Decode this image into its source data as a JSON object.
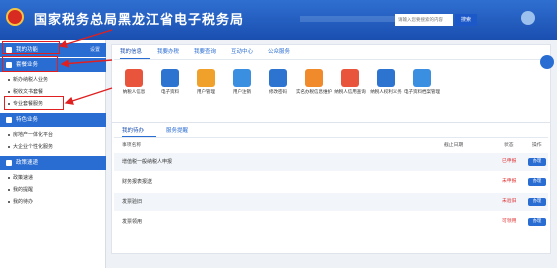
{
  "header": {
    "title": "国家税务总局黑龙江省电子税务局",
    "search_placeholder": "请输入您要搜索的内容",
    "search_label": "搜索"
  },
  "sidebar": {
    "sections": [
      {
        "label": "我的功能",
        "extra": "设置"
      },
      {
        "label": "套餐业务",
        "items": [
          "新办纳税人业务",
          "税收文书套餐",
          "专业套餐服务"
        ]
      },
      {
        "label": "特色业务",
        "items": [
          "房地产一体化平台",
          "大企业个性化服务"
        ]
      },
      {
        "label": "政策速递",
        "items": [
          "政策速递",
          "我的提醒",
          "我的待办"
        ]
      }
    ]
  },
  "main": {
    "tabs": [
      "我的信息",
      "我要办税",
      "我要查询",
      "互动中心",
      "公众服务"
    ],
    "functions": [
      {
        "label": "纳税人信息",
        "icon": "taxpayer-info-icon",
        "color": "#e9543d"
      },
      {
        "label": "电子资料",
        "icon": "electronic-data-icon",
        "color": "#2d74d0"
      },
      {
        "label": "用户管理",
        "icon": "user-management-icon",
        "color": "#f0a12b"
      },
      {
        "label": "用户注销",
        "icon": "user-cancel-icon",
        "color": "#3b8fe0"
      },
      {
        "label": "修改密码",
        "icon": "change-password-icon",
        "color": "#2d74d0"
      },
      {
        "label": "实名办税信息维护",
        "icon": "real-name-icon",
        "color": "#f08a2b"
      },
      {
        "label": "纳税人信用查询",
        "icon": "credit-query-icon",
        "color": "#e9543d"
      },
      {
        "label": "纳税人权利义务",
        "icon": "rights-icon",
        "color": "#2d74d0"
      },
      {
        "label": "电子资料档案管理",
        "icon": "archive-icon",
        "color": "#3b8fe0"
      }
    ],
    "todo": {
      "tabs": [
        "我的待办",
        "服务提醒"
      ],
      "columns": [
        "事项名称",
        "截止日期",
        "状态",
        "操作"
      ],
      "rows": [
        {
          "name": "增值税一般纳税人申报",
          "status": "已申报",
          "action": "办理"
        },
        {
          "name": "财务报表报送",
          "status": "未申报",
          "action": "办理"
        },
        {
          "name": "发票验旧",
          "status": "未验旧",
          "action": "办理"
        },
        {
          "name": "发票领用",
          "status": "可领用",
          "action": "办理"
        }
      ]
    }
  },
  "colors": {
    "accent": "#2a6dd2",
    "header": "#1a4fb0",
    "annotation": "#e02020",
    "status": "#e03030"
  }
}
